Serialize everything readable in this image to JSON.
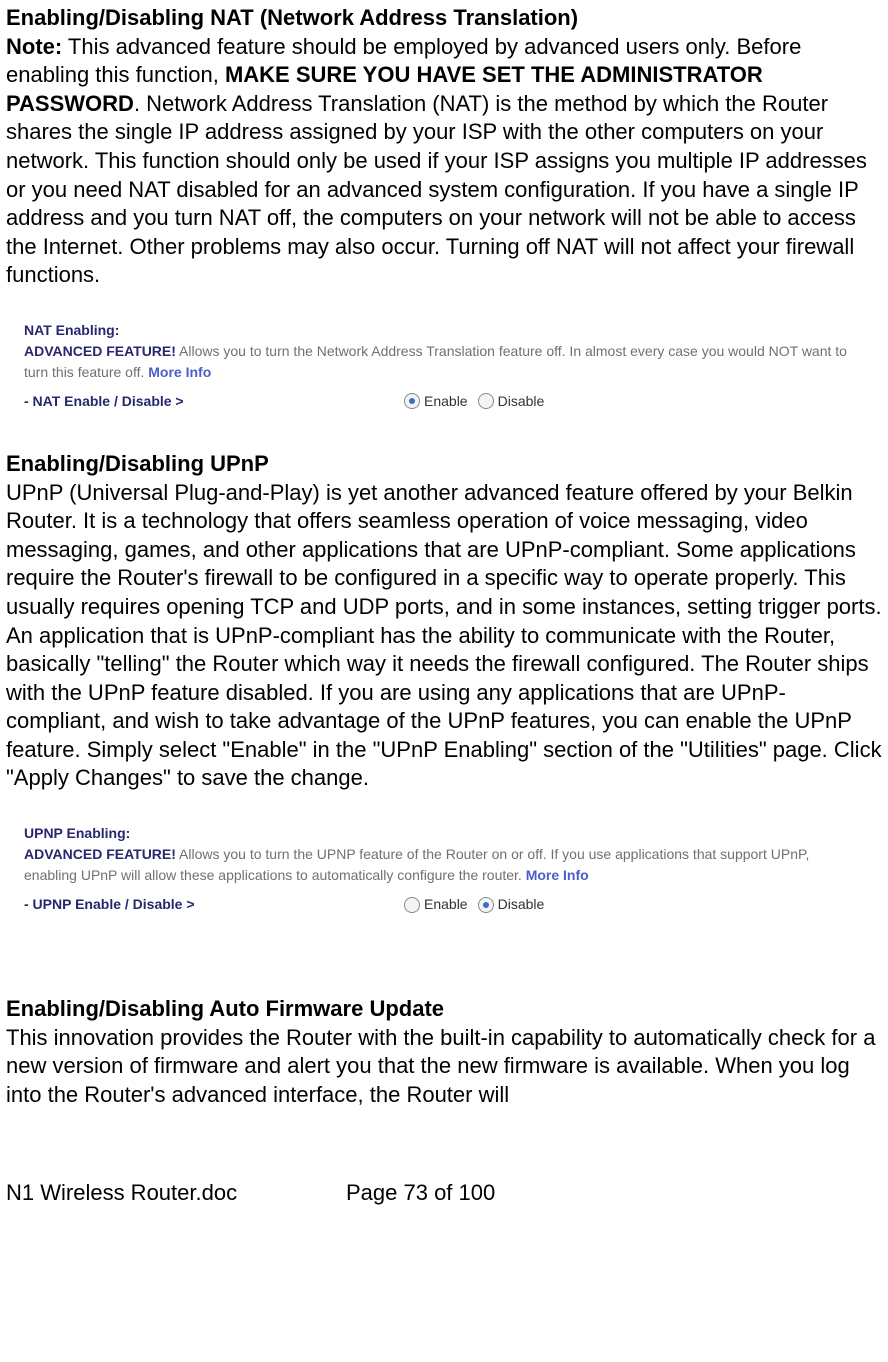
{
  "nat": {
    "heading": "Enabling/Disabling NAT (Network Address Translation)",
    "note_label": "Note:",
    "para_part1": " This advanced feature should be employed by advanced users only. Before enabling this function, ",
    "para_bold": "MAKE SURE YOU HAVE SET THE ADMINISTRATOR PASSWORD",
    "para_part2": ". Network Address Translation (NAT) is the method by which the Router shares the single IP address assigned by your ISP with the other computers on your network. This function should only be used if your ISP assigns you multiple IP addresses or you need NAT disabled for an advanced system configuration. If you have a single IP address and you turn NAT off, the computers on your network will not be able to access the Internet. Other problems may also occur. Turning off NAT will not affect your firewall functions.",
    "ui": {
      "title": "NAT Enabling:",
      "adv_label": "ADVANCED FEATURE!",
      "desc": " Allows you to turn the Network Address Translation feature off. In almost every case you would NOT want to turn this feature off. ",
      "more": "More Info",
      "ctrl": "- NAT Enable / Disable >",
      "opt_enable": "Enable",
      "opt_disable": "Disable",
      "selected": "enable"
    }
  },
  "upnp": {
    "heading": "Enabling/Disabling UPnP",
    "para": "UPnP (Universal Plug-and-Play) is yet another advanced feature offered by your Belkin Router. It is a technology that offers seamless operation of voice messaging, video messaging, games, and other applications that are UPnP-compliant. Some applications require the Router's firewall to be configured in a specific way to operate properly. This usually requires opening TCP and UDP ports, and in some instances, setting trigger ports. An application that is UPnP-compliant has the ability to communicate with the Router, basically \"telling\" the Router which way it needs the firewall configured. The Router ships with the UPnP feature disabled. If you are using any applications that are UPnP-compliant, and wish to take advantage of the UPnP features, you can enable the UPnP feature. Simply select \"Enable\" in the \"UPnP Enabling\" section of the \"Utilities\" page. Click \"Apply Changes\" to save the change.",
    "ui": {
      "title": "UPNP Enabling:",
      "adv_label": "ADVANCED FEATURE!",
      "desc": " Allows you to turn the UPNP feature of the Router on or off. If you use applications that support UPnP, enabling UPnP will allow these applications to automatically configure the router. ",
      "more": "More Info",
      "ctrl": "- UPNP Enable / Disable >",
      "opt_enable": "Enable",
      "opt_disable": "Disable",
      "selected": "disable"
    }
  },
  "firmware": {
    "heading": "Enabling/Disabling Auto Firmware Update",
    "para": "This innovation provides the Router with the built-in capability to automatically check for a new version of firmware and alert you that the new firmware is available. When you log into the Router's advanced interface, the Router will"
  },
  "footer": {
    "doc": "N1 Wireless Router.doc",
    "page": "Page 73 of 100"
  }
}
